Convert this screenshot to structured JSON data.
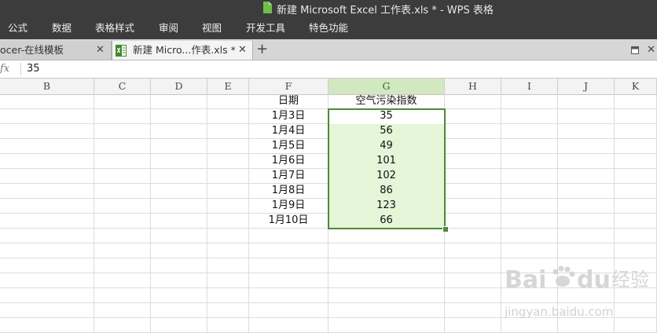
{
  "window": {
    "title": "新建 Microsoft Excel 工作表.xls * - WPS 表格"
  },
  "menu": {
    "items": [
      "公式",
      "数据",
      "表格样式",
      "审阅",
      "视图",
      "开发工具",
      "特色功能"
    ]
  },
  "tabs": [
    {
      "label": "ocer-在线模板",
      "active": false
    },
    {
      "label": "新建 Micro...作表.xls *",
      "active": true
    }
  ],
  "formula_bar": {
    "fx_label": "fx",
    "value": "35"
  },
  "columns": [
    "B",
    "C",
    "D",
    "E",
    "F",
    "G",
    "H",
    "I",
    "J",
    "K"
  ],
  "selected_column": "G",
  "table": {
    "header_date": "日期",
    "header_value": "空气污染指数",
    "rows": [
      {
        "date": "1月3日",
        "value": "35"
      },
      {
        "date": "1月4日",
        "value": "56"
      },
      {
        "date": "1月5日",
        "value": "49"
      },
      {
        "date": "1月6日",
        "value": "101"
      },
      {
        "date": "1月7日",
        "value": "102"
      },
      {
        "date": "1月8日",
        "value": "86"
      },
      {
        "date": "1月9日",
        "value": "123"
      },
      {
        "date": "1月10日",
        "value": "66"
      }
    ]
  },
  "watermark": {
    "brand": "Bai",
    "brand2": "du",
    "cn": "经验",
    "url": "jingyan.baidu.com"
  },
  "colors": {
    "selection_border": "#4e8a36",
    "selection_fill": "#e4f5d8",
    "selected_header": "#d2e8c0",
    "titlebar": "#3c3c3c"
  }
}
